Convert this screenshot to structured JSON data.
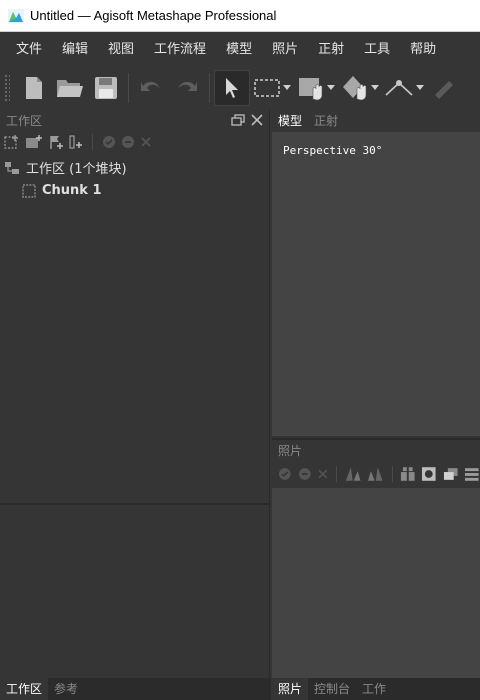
{
  "window": {
    "title": "Untitled — Agisoft Metashape Professional"
  },
  "menu": [
    {
      "label": "文件"
    },
    {
      "label": "编辑"
    },
    {
      "label": "视图"
    },
    {
      "label": "工作流程"
    },
    {
      "label": "模型"
    },
    {
      "label": "照片"
    },
    {
      "label": "正射"
    },
    {
      "label": "工具"
    },
    {
      "label": "帮助"
    }
  ],
  "toolbar": {
    "icons": [
      "new-document-icon",
      "open-folder-icon",
      "save-icon",
      "undo-icon",
      "redo-icon",
      "select-arrow-icon",
      "rectangle-select-icon",
      "navigation-hand-icon",
      "shape-tool-icon",
      "ruler-point-icon",
      "ruler-icon"
    ]
  },
  "workspace": {
    "title": "工作区",
    "root_label": "工作区 (1个堆块)",
    "chunk_label": "Chunk 1"
  },
  "left_tabs": [
    {
      "label": "工作区",
      "active": true
    },
    {
      "label": "参考",
      "active": false
    }
  ],
  "model_tabs": [
    {
      "label": "模型",
      "active": true
    },
    {
      "label": "正射",
      "active": false
    }
  ],
  "model_view": {
    "projection_label": "Perspective 30°",
    "background": "#444444"
  },
  "photos": {
    "title": "照片"
  },
  "right_bottom_tabs": [
    {
      "label": "照片",
      "active": true
    },
    {
      "label": "控制台",
      "active": false
    },
    {
      "label": "工作",
      "active": false
    }
  ]
}
